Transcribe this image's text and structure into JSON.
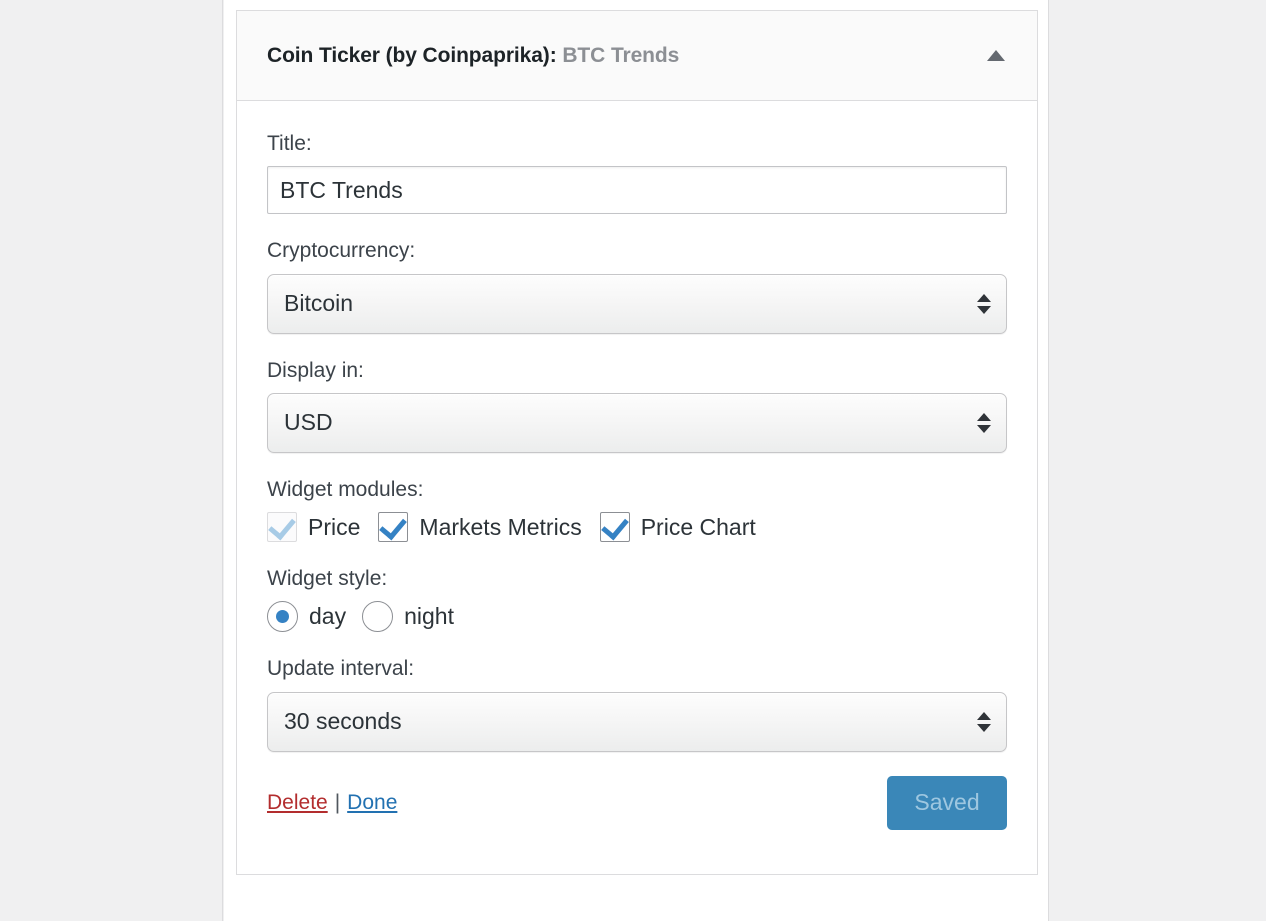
{
  "widget": {
    "header": {
      "plugin_name": "Coin Ticker (by Coinpaprika)",
      "separator": ":",
      "instance_title": "BTC Trends",
      "toggle_icon": "triangle-up-icon"
    },
    "fields": {
      "title": {
        "label": "Title:",
        "value": "BTC Trends",
        "placeholder": ""
      },
      "cryptocurrency": {
        "label": "Cryptocurrency:",
        "value": "Bitcoin"
      },
      "display_in": {
        "label": "Display in:",
        "value": "USD"
      },
      "widget_modules": {
        "label": "Widget modules:",
        "options": [
          {
            "label": "Price",
            "checked": true,
            "disabled": true
          },
          {
            "label": "Markets Metrics",
            "checked": true,
            "disabled": false
          },
          {
            "label": "Price Chart",
            "checked": true,
            "disabled": false
          }
        ]
      },
      "widget_style": {
        "label": "Widget style:",
        "options": [
          {
            "label": "day",
            "selected": true
          },
          {
            "label": "night",
            "selected": false
          }
        ]
      },
      "update_interval": {
        "label": "Update interval:",
        "value": "30 seconds"
      }
    },
    "footer": {
      "delete_label": "Delete",
      "separator": "|",
      "done_label": "Done",
      "save_button_label": "Saved"
    }
  },
  "colors": {
    "accent_blue": "#3582c4",
    "link_blue": "#2271b1",
    "delete_red": "#b32d2e",
    "button_blue": "#3a87b8",
    "button_text": "#9ec7e0",
    "panel_border": "#dcdcde",
    "page_background": "#f0f0f1"
  }
}
